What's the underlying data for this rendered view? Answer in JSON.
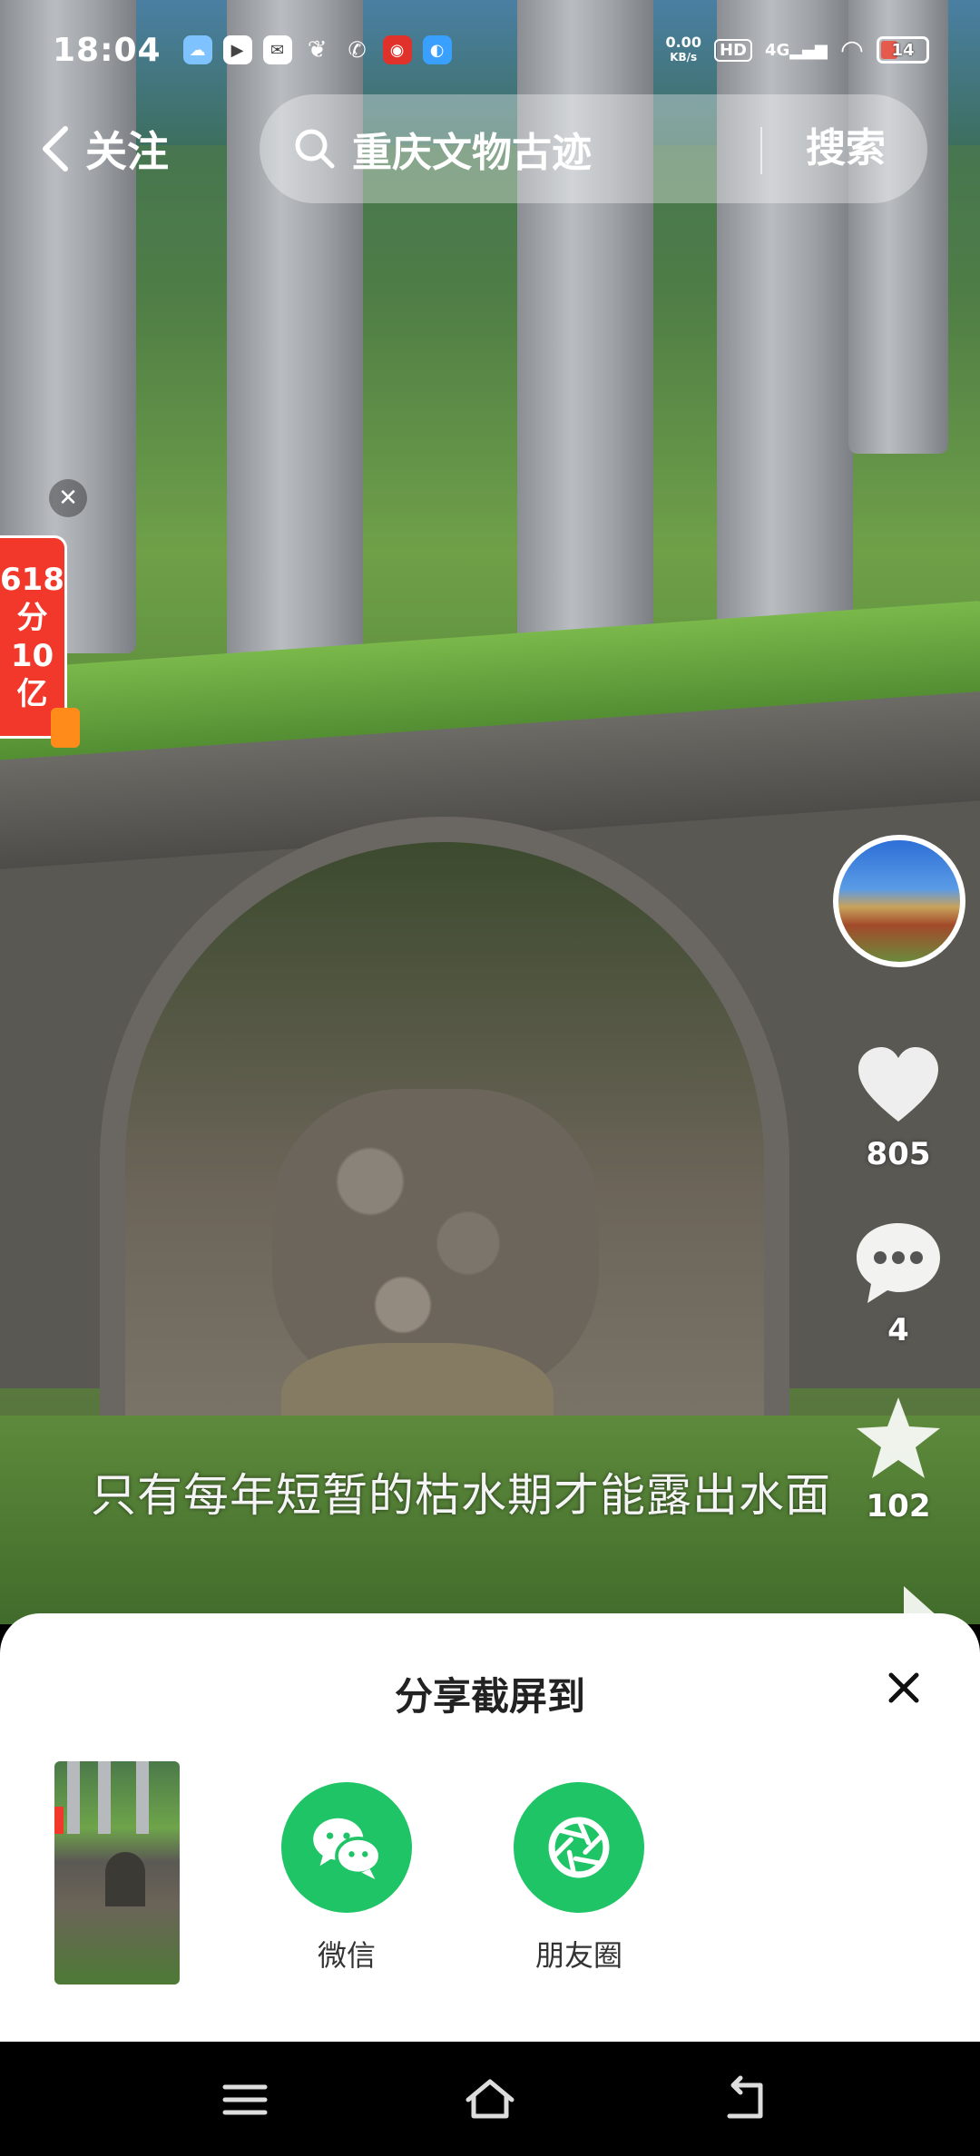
{
  "status_bar": {
    "time": "18:04",
    "net_speed_value": "0.00",
    "net_speed_unit": "KB/s",
    "hd_badge": "HD",
    "signal": "4G",
    "battery_level": "14",
    "battery_color": "#e65a4d"
  },
  "top_nav": {
    "back_label": "关注",
    "search_query": "重庆文物古迹",
    "search_button": "搜索"
  },
  "promo": {
    "line1": "618",
    "line2": "分",
    "line3": "10",
    "line4": "亿",
    "close_symbol": "✕",
    "color": "#f2382b"
  },
  "actions": {
    "like_count": "805",
    "comment_count": "4",
    "favorite_count": "102"
  },
  "video": {
    "caption": "只有每年短暂的枯水期才能露出水面"
  },
  "share_sheet": {
    "title": "分享截屏到",
    "targets": [
      {
        "label": "微信",
        "icon": "wechat-icon",
        "color": "#1fc466"
      },
      {
        "label": "朋友圈",
        "icon": "moments-icon",
        "color": "#1fc466"
      }
    ]
  },
  "nav_bar": {
    "buttons": [
      "menu-icon",
      "home-icon",
      "back-icon"
    ]
  }
}
